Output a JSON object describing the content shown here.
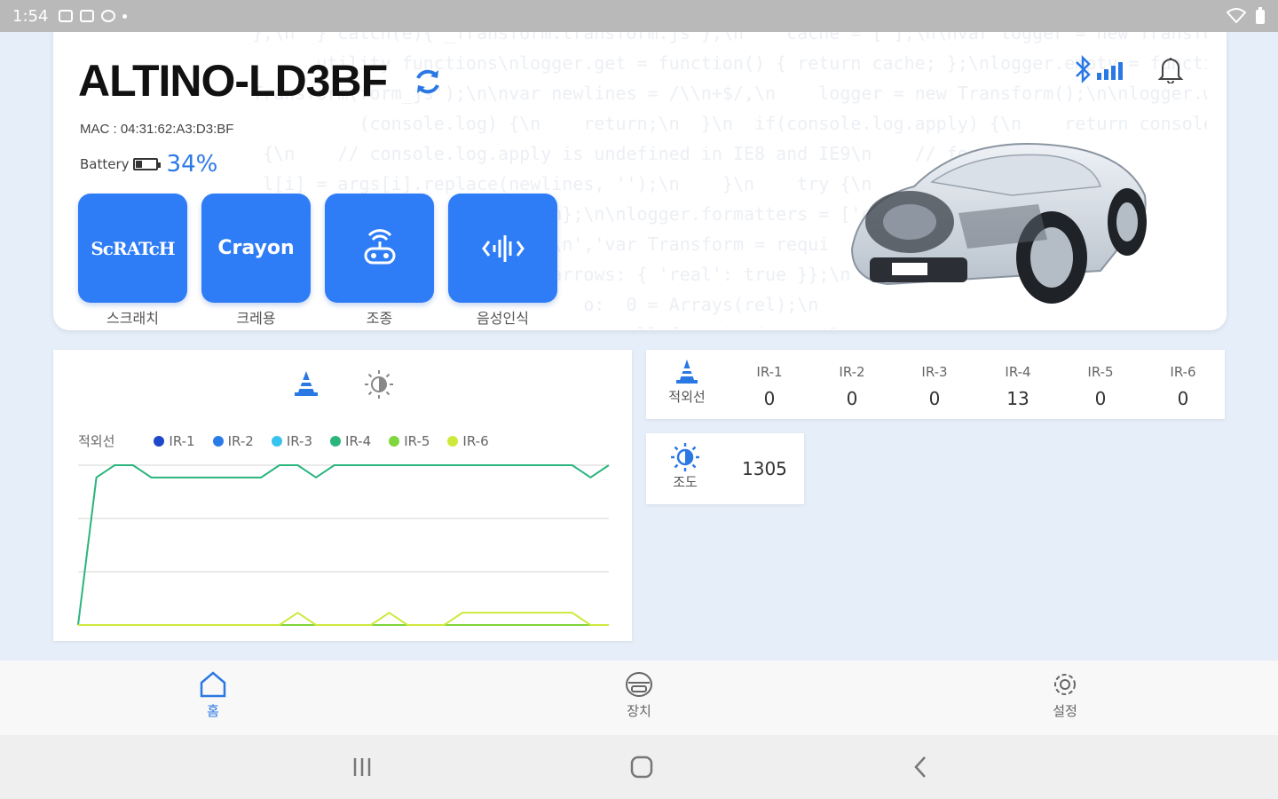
{
  "status_bar": {
    "time": "1:54",
    "icons": [
      "image-icon",
      "screenshot-icon",
      "settings-circle-icon",
      "dot-icon",
      "wifi-icon",
      "battery-icon"
    ]
  },
  "header": {
    "device_name": "ALTINO-LD3BF",
    "mac": "MAC : 04:31:62:A3:D3:BF",
    "battery_label": "Battery",
    "battery_percent": "34%",
    "battery_level": 0.34,
    "icons": [
      "refresh-icon",
      "bluetooth-icon",
      "signal-icon",
      "bell-icon"
    ]
  },
  "modes": [
    {
      "label": "스크래치",
      "logo": "ScRATcH",
      "icon": "scratch-logo-icon"
    },
    {
      "label": "크레용",
      "logo": "Crayon",
      "icon": "crayon-logo-icon"
    },
    {
      "label": "조종",
      "icon": "remote-control-icon"
    },
    {
      "label": "음성인식",
      "icon": "voice-wave-icon"
    }
  ],
  "chart_panel": {
    "tabs": [
      {
        "name": "ir",
        "icon": "cone-icon",
        "active": true
      },
      {
        "name": "light",
        "icon": "brightness-icon",
        "active": false
      }
    ],
    "legend_title": "적외선",
    "colors": {
      "IR-1": "#1f47c9",
      "IR-2": "#2a7be8",
      "IR-3": "#38c2ee",
      "IR-4": "#2ab57d",
      "IR-5": "#7fd63d",
      "IR-6": "#cfe83c"
    }
  },
  "chart_data": {
    "type": "line",
    "title": "",
    "legend_title": "적외선",
    "x": [
      0,
      1,
      2,
      3,
      4,
      5,
      6,
      7,
      8,
      9,
      10,
      11,
      12,
      13,
      14,
      15,
      16,
      17,
      18,
      19,
      20,
      21,
      22,
      23,
      24,
      25,
      26,
      27,
      28,
      29
    ],
    "ylim": [
      0,
      13
    ],
    "grid": true,
    "series": [
      {
        "name": "IR-1",
        "values": [
          0,
          0,
          0,
          0,
          0,
          0,
          0,
          0,
          0,
          0,
          0,
          0,
          0,
          0,
          0,
          0,
          0,
          0,
          0,
          0,
          0,
          0,
          0,
          0,
          0,
          0,
          0,
          0,
          0,
          0
        ]
      },
      {
        "name": "IR-2",
        "values": [
          0,
          0,
          0,
          0,
          0,
          0,
          0,
          0,
          0,
          0,
          0,
          0,
          0,
          0,
          0,
          0,
          0,
          0,
          0,
          0,
          0,
          0,
          0,
          0,
          0,
          0,
          0,
          0,
          0,
          0
        ]
      },
      {
        "name": "IR-3",
        "values": [
          0,
          0,
          0,
          0,
          0,
          0,
          0,
          0,
          0,
          0,
          0,
          0,
          0,
          0,
          0,
          0,
          0,
          0,
          0,
          0,
          0,
          0,
          0,
          0,
          0,
          0,
          0,
          0,
          0,
          0
        ]
      },
      {
        "name": "IR-4",
        "values": [
          0,
          12,
          13,
          13,
          12,
          12,
          12,
          12,
          12,
          12,
          12,
          13,
          13,
          12,
          13,
          13,
          13,
          13,
          13,
          13,
          13,
          13,
          13,
          13,
          13,
          13,
          13,
          13,
          12,
          13
        ]
      },
      {
        "name": "IR-5",
        "values": [
          0,
          0,
          0,
          0,
          0,
          0,
          0,
          0,
          0,
          0,
          0,
          0,
          0,
          0,
          0,
          0,
          0,
          0,
          0,
          0,
          0,
          0,
          0,
          0,
          0,
          0,
          0,
          0,
          0,
          0
        ]
      },
      {
        "name": "IR-6",
        "values": [
          0,
          0,
          0,
          0,
          0,
          0,
          0,
          0,
          0,
          0,
          0,
          0,
          1,
          0,
          0,
          0,
          0,
          1,
          0,
          0,
          0,
          1,
          1,
          1,
          1,
          1,
          1,
          1,
          0,
          0
        ]
      }
    ]
  },
  "ir_panel": {
    "label": "적외선",
    "sensors": [
      {
        "name": "IR-1",
        "value": "0"
      },
      {
        "name": "IR-2",
        "value": "0"
      },
      {
        "name": "IR-3",
        "value": "0"
      },
      {
        "name": "IR-4",
        "value": "13"
      },
      {
        "name": "IR-5",
        "value": "0"
      },
      {
        "name": "IR-6",
        "value": "0"
      }
    ]
  },
  "light_panel": {
    "label": "조도",
    "value": "1305"
  },
  "bottom_nav": [
    {
      "label": "홈",
      "icon": "home-icon",
      "active": true
    },
    {
      "label": "장치",
      "icon": "device-car-icon",
      "active": false
    },
    {
      "label": "설정",
      "icon": "gear-icon",
      "active": false
    }
  ],
  "system_nav": [
    {
      "icon": "recent-apps-icon"
    },
    {
      "icon": "home-circle-icon"
    },
    {
      "icon": "back-icon"
    }
  ],
  "accent_color": "#2e7cf6"
}
